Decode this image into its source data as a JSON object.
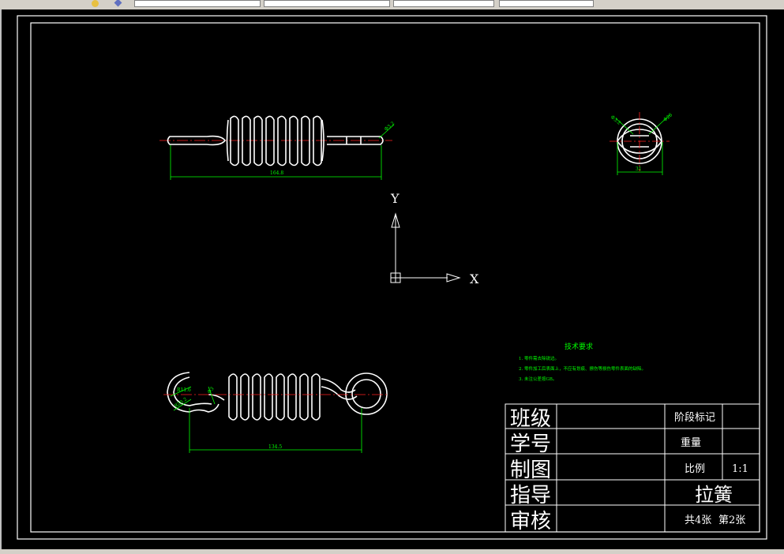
{
  "toolbar": {
    "fields": [
      "",
      "",
      "",
      "",
      "",
      ""
    ]
  },
  "drawing": {
    "dimensions": {
      "top_length": "164.8",
      "top_wire": "Φ3.2",
      "side_left": "Φ3.2",
      "side_right": "Φ28",
      "side_width": "31",
      "bottom_length": "134.5",
      "bottom_radius": "R11.6",
      "bottom_r2": "R20.2",
      "bottom_small": "Φ3"
    },
    "ucs": {
      "x_label": "X",
      "y_label": "Y"
    },
    "tech": {
      "title": "技术要求",
      "lines": [
        "1. 零件需去除锐边。",
        "2. 零件加工后表面上，不应有划痕、擦伤等损伤零件表面的缺陷。",
        "3. 未注公差按GB。"
      ]
    },
    "title_block": {
      "class": "班级",
      "student_no": "学号",
      "drawn": "制图",
      "advisor": "指导",
      "review": "审核",
      "stage_mark": "阶段标记",
      "weight": "重量",
      "scale_label": "比例",
      "scale_value": "1:1",
      "part_name": "拉簧",
      "sheets": "共4张",
      "sheet_no": "第2张"
    }
  },
  "colors": {
    "background": "#000000",
    "lines": "#ffffff",
    "centerline": "#ff2020",
    "dimension": "#00ff00"
  }
}
